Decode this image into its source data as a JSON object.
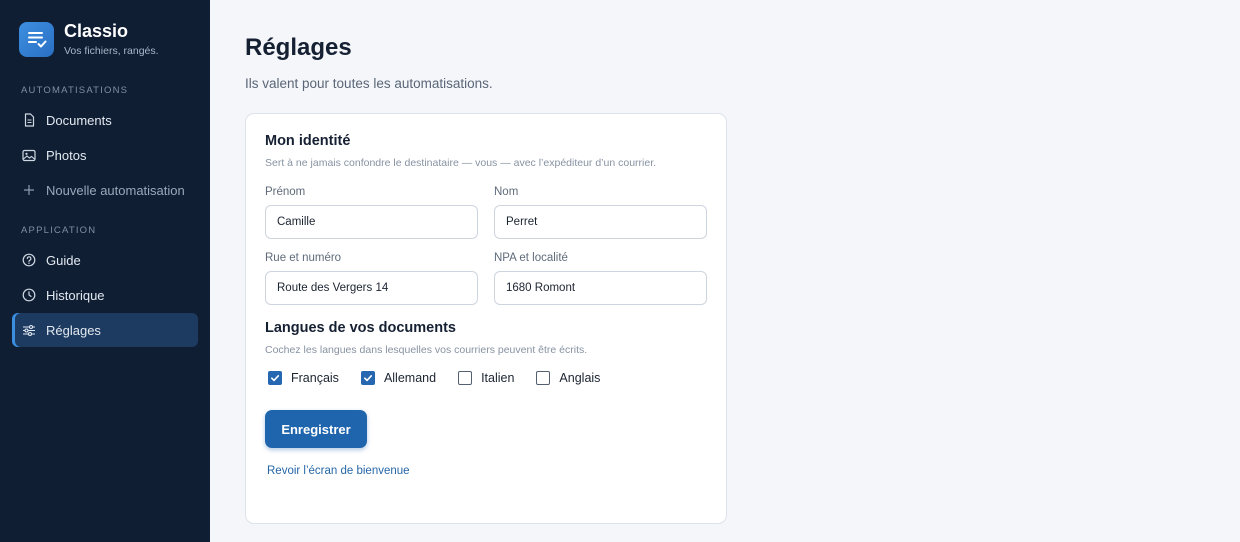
{
  "brand": {
    "name": "Classio",
    "tagline": "Vos fichiers, rangés."
  },
  "sidebar": {
    "section_automations": "AUTOMATISATIONS",
    "section_application": "APPLICATION",
    "items": [
      {
        "label": "Documents",
        "icon": "document-icon"
      },
      {
        "label": "Photos",
        "icon": "image-icon"
      },
      {
        "label": "Nouvelle automatisation",
        "icon": "plus-icon"
      },
      {
        "label": "Guide",
        "icon": "help-circle-icon"
      },
      {
        "label": "Historique",
        "icon": "clock-icon"
      },
      {
        "label": "Réglages",
        "icon": "sliders-icon",
        "active": true
      }
    ]
  },
  "page": {
    "title": "Réglages",
    "subtitle": "Ils valent pour toutes les automatisations."
  },
  "identity": {
    "heading": "Mon identité",
    "description": "Sert à ne jamais confondre le destinataire — vous — avec l’expéditeur d’un courrier.",
    "first_name": {
      "label": "Prénom",
      "value": "Camille"
    },
    "last_name": {
      "label": "Nom",
      "value": "Perret"
    },
    "street": {
      "label": "Rue et numéro",
      "value": "Route des Vergers 14"
    },
    "city": {
      "label": "NPA et localité",
      "value": "1680 Romont"
    }
  },
  "languages": {
    "heading": "Langues de vos documents",
    "description": "Cochez les langues dans lesquelles vos courriers peuvent être écrits.",
    "options": [
      {
        "label": "Français",
        "checked": true
      },
      {
        "label": "Allemand",
        "checked": true
      },
      {
        "label": "Italien",
        "checked": false
      },
      {
        "label": "Anglais",
        "checked": false
      }
    ]
  },
  "actions": {
    "save_label": "Enregistrer",
    "welcome_link": "Revoir l’écran de bienvenue"
  },
  "colors": {
    "sidebar_bg": "#0f1e33",
    "accent": "#1f65ad",
    "active_item_bg": "#1d3b60",
    "page_bg": "#f4f6f9"
  }
}
